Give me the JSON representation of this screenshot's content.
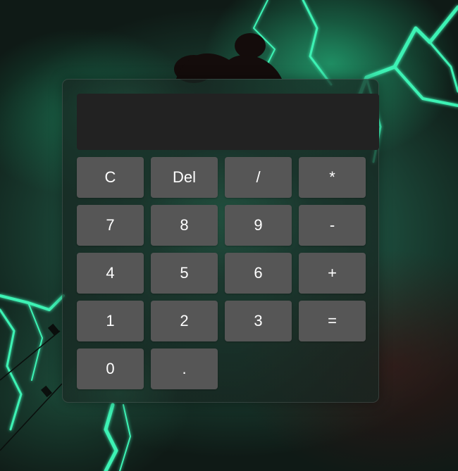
{
  "display": {
    "value": ""
  },
  "keys": {
    "clear": "C",
    "delete": "Del",
    "divide": "/",
    "multiply": "*",
    "seven": "7",
    "eight": "8",
    "nine": "9",
    "subtract": "-",
    "four": "4",
    "five": "5",
    "six": "6",
    "add": "+",
    "one": "1",
    "two": "2",
    "three": "3",
    "equals": "=",
    "zero": "0",
    "decimal": "."
  },
  "colors": {
    "key_background": "#565656",
    "display_background": "#222222",
    "text": "#ffffff",
    "accent_glow": "#3ff0b0"
  }
}
